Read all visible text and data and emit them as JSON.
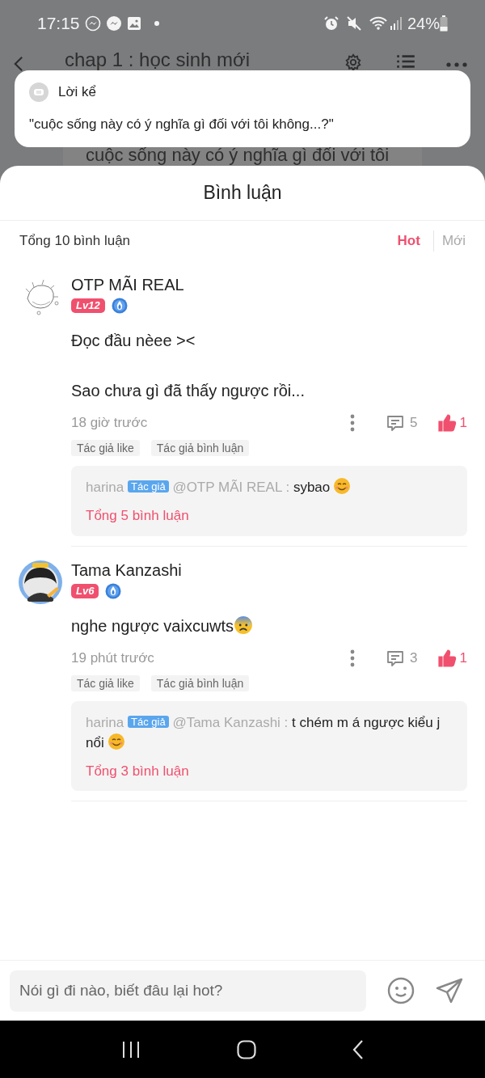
{
  "status_bar": {
    "time": "17:15",
    "battery": "24%"
  },
  "app_bar": {
    "title": "chap 1 : học sinh mới"
  },
  "story_text": "cuộc sống này có ý nghĩa gì đối với tôi",
  "narration_popup": {
    "label": "Lời kể",
    "text": "\"cuộc sống này có ý nghĩa gì đối với tôi không...?\""
  },
  "comments_sheet": {
    "title": "Bình luận",
    "total": "Tổng 10 bình luận",
    "sort_tabs": [
      {
        "label": "Hot",
        "selected": true
      },
      {
        "label": "Mới",
        "selected": false
      }
    ],
    "comments": [
      {
        "user": "OTP MÃI REAL",
        "level": "Lv12",
        "body": [
          "Đọc đầu nèee ><",
          "Sao chưa gì đã thấy ngược rồi..."
        ],
        "emoji_after_body": false,
        "time": "18 giờ trước",
        "reply_count": "5",
        "likes": "1",
        "liked": true,
        "tags": [
          "Tác giả like",
          "Tác giả bình luận"
        ],
        "reply": {
          "author": "harina",
          "badge": "Tác giả",
          "mention": "@OTP MÃI REAL :",
          "text": "sybao",
          "emoji_after_text": true,
          "total": "Tổng 5 bình luận"
        }
      },
      {
        "user": "Tama Kanzashi",
        "level": "Lv6",
        "body": [
          "nghe ngược vaixcuwts"
        ],
        "emoji_after_body": true,
        "time": "19 phút trước",
        "reply_count": "3",
        "likes": "1",
        "liked": true,
        "tags": [
          "Tác giả like",
          "Tác giả bình luận"
        ],
        "reply": {
          "author": "harina",
          "badge": "Tác giả",
          "mention": "@Tama Kanzashi :",
          "text": "t chém m á ngược kiểu j nổi",
          "emoji_after_text": true,
          "total": "Tổng 3 bình luận"
        }
      }
    ]
  },
  "comment_input": {
    "placeholder": "Nói gì đi nào, biết đâu lại hot?"
  }
}
